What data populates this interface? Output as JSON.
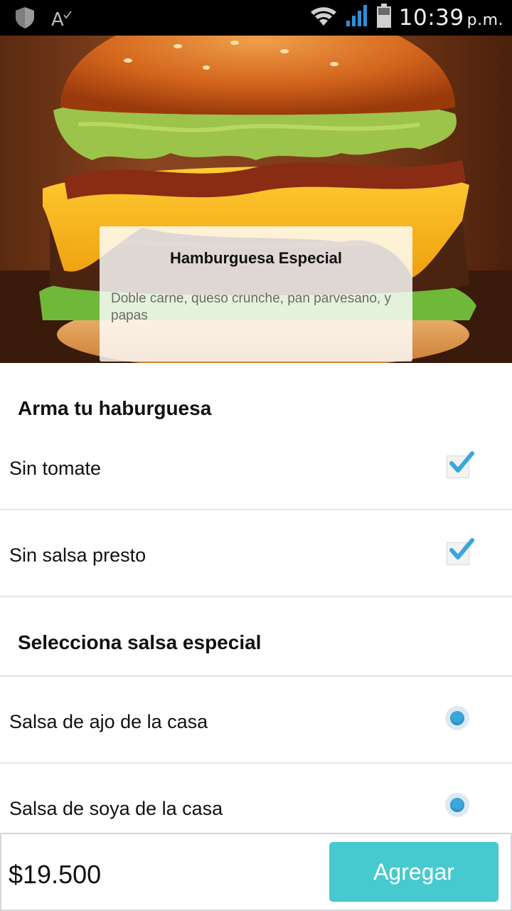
{
  "status_bar": {
    "time": "10:39",
    "ampm": "p.m.",
    "font_icon_text": "A",
    "icons": [
      "shield-icon",
      "font-check-icon",
      "wifi-icon",
      "signal-icon",
      "battery-icon"
    ]
  },
  "product": {
    "title": "Hamburguesa Especial",
    "description": "Doble carne, queso crunche, pan parvesano, y papas"
  },
  "sections": {
    "build": {
      "title": "Arma tu haburguesa",
      "options": [
        {
          "label": "Sin tomate",
          "checked": true
        },
        {
          "label": "Sin salsa presto",
          "checked": true
        }
      ]
    },
    "sauce": {
      "title": "Selecciona salsa especial",
      "options": [
        {
          "label": "Salsa de ajo de la casa",
          "selected": true
        },
        {
          "label": "Salsa de soya de la casa",
          "selected": true
        }
      ]
    }
  },
  "footer": {
    "price": "$19.500",
    "add_label": "Agregar"
  },
  "colors": {
    "accent": "#47cacf",
    "check": "#3aa6dc",
    "status_bar": "#000000"
  }
}
